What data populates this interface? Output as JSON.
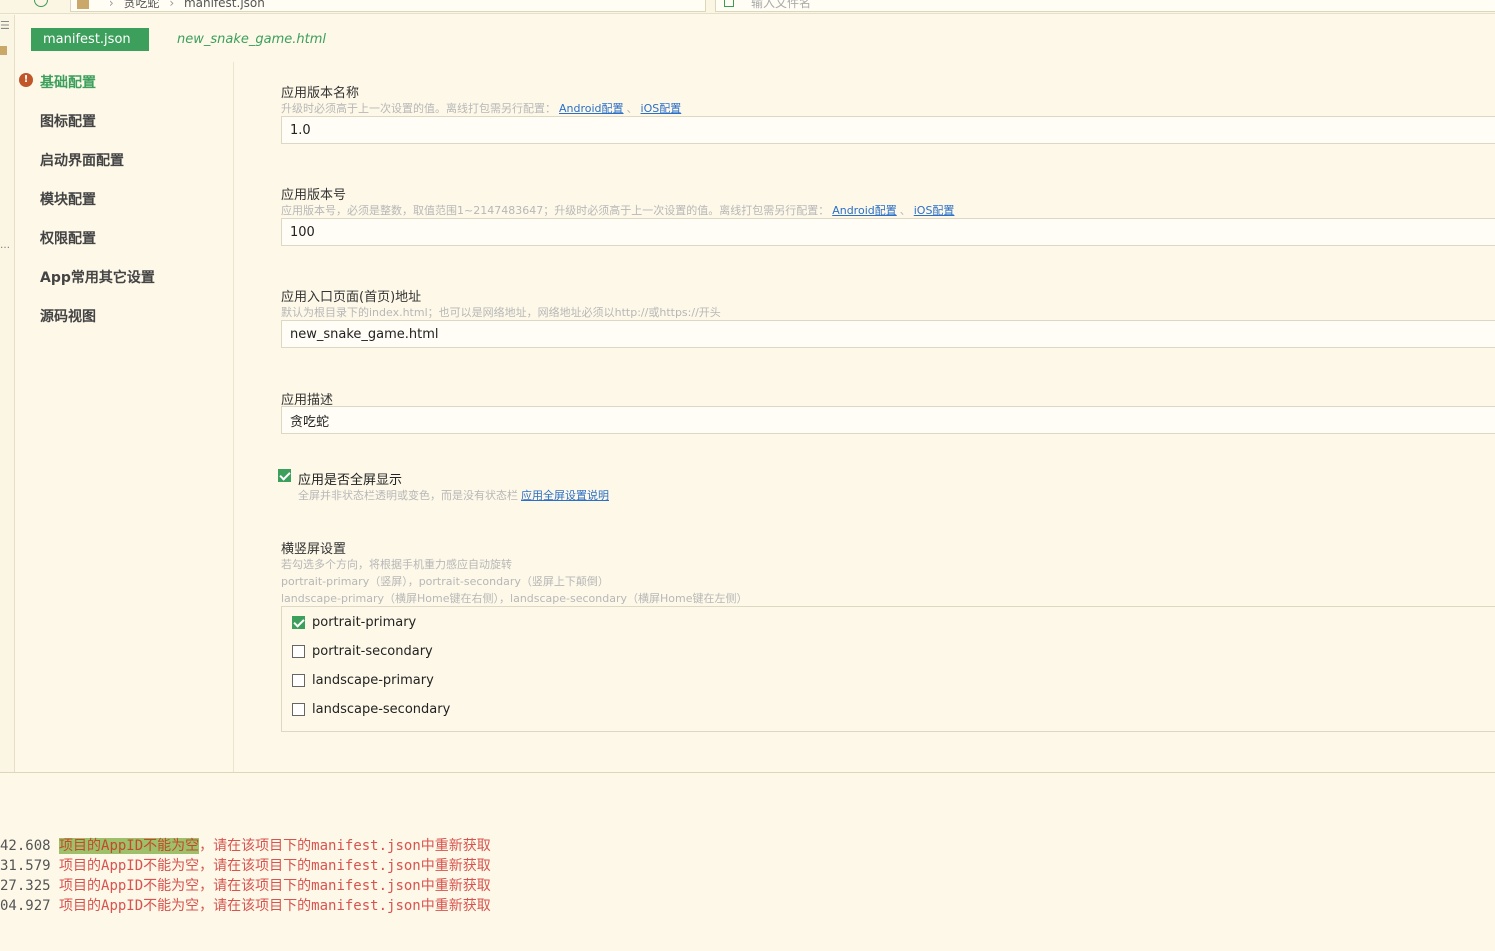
{
  "breadcrumb": {
    "project": "贪吃蛇",
    "file": "manifest.json"
  },
  "search": {
    "placeholder": "输入文件名"
  },
  "tabs": [
    {
      "label": "manifest.json",
      "active": true
    },
    {
      "label": "new_snake_game.html",
      "active": false
    }
  ],
  "nav": {
    "items": [
      {
        "label": "基础配置",
        "active": true,
        "warning": true
      },
      {
        "label": "图标配置"
      },
      {
        "label": "启动界面配置"
      },
      {
        "label": "模块配置"
      },
      {
        "label": "权限配置"
      },
      {
        "label": "App常用其它设置"
      },
      {
        "label": "源码视图"
      }
    ]
  },
  "form": {
    "version_name": {
      "label": "应用版本名称",
      "hint": "升级时必须高于上一次设置的值。离线打包需另行配置：",
      "android_link": "Android配置",
      "ios_link": "iOS配置",
      "value": "1.0"
    },
    "version_code": {
      "label": "应用版本号",
      "hint": "应用版本号，必须是整数，取值范围1~2147483647；升级时必须高于上一次设置的值。离线打包需另行配置：",
      "android_link": "Android配置",
      "ios_link": "iOS配置",
      "value": "100"
    },
    "entry": {
      "label": "应用入口页面(首页)地址",
      "hint": "默认为根目录下的index.html；也可以是网络地址，网络地址必须以http://或https://开头",
      "value": "new_snake_game.html"
    },
    "description": {
      "label": "应用描述",
      "value": "贪吃蛇"
    },
    "fullscreen": {
      "label": "应用是否全屏显示",
      "checked": true,
      "hint": "全屏并非状态栏透明或变色，而是没有状态栏",
      "link": "应用全屏设置说明"
    },
    "orientation": {
      "label": "横竖屏设置",
      "hint1": "若勾选多个方向，将根据手机重力感应自动旋转",
      "hint2": "portrait-primary（竖屏），portrait-secondary（竖屏上下颠倒）",
      "hint3": "landscape-primary（横屏Home键在右侧），landscape-secondary（横屏Home键在左侧）",
      "options": [
        {
          "label": "portrait-primary",
          "checked": true
        },
        {
          "label": "portrait-secondary",
          "checked": false
        },
        {
          "label": "landscape-primary",
          "checked": false
        },
        {
          "label": "landscape-secondary",
          "checked": false
        }
      ]
    }
  },
  "console": {
    "lines": [
      {
        "time": "42.608",
        "highlight": "项目的AppID不能为空",
        "msg": "，请在该项目下的manifest.json中重新获取"
      },
      {
        "time": "31.579",
        "msg": "项目的AppID不能为空，请在该项目下的manifest.json中重新获取"
      },
      {
        "time": "27.325",
        "msg": "项目的AppID不能为空，请在该项目下的manifest.json中重新获取"
      },
      {
        "time": "04.927",
        "msg": "项目的AppID不能为空，请在该项目下的manifest.json中重新获取"
      }
    ]
  }
}
